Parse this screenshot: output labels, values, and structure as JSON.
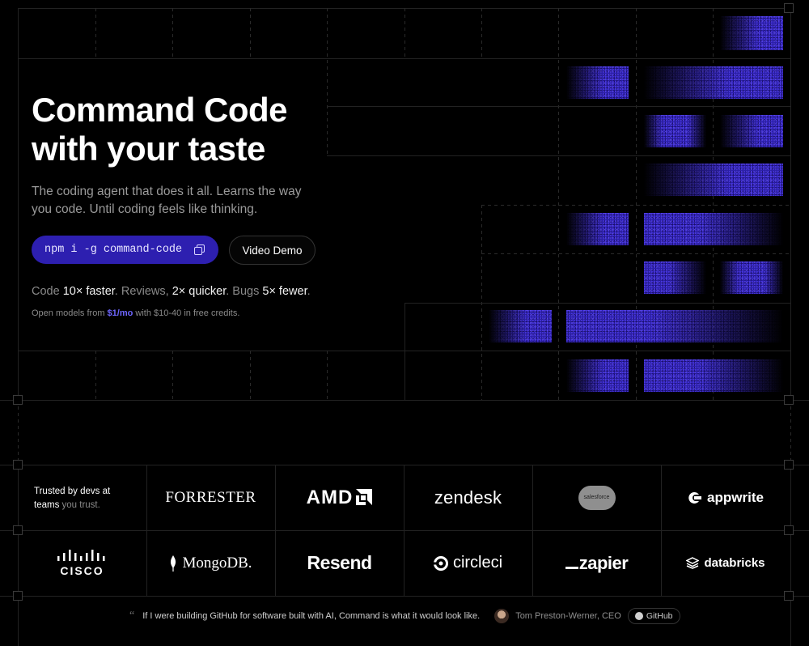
{
  "hero": {
    "title": "Command Code with your taste",
    "subtitle": "The coding agent that does it all. Learns the way you code. Until coding feels like thinking.",
    "install_command": "npm i -g command-code",
    "video_demo_label": "Video Demo",
    "stats": {
      "s1": "Code ",
      "s1b": "10× faster",
      "s2": ". Reviews, ",
      "s2b": "2× quicker",
      "s3": ". Bugs ",
      "s3b": "5× fewer",
      "s4": "."
    },
    "credits": {
      "prefix": "Open models from ",
      "price": "$1/mo",
      "suffix": " with $10-40 in free credits."
    }
  },
  "trusted": {
    "line1": "Trusted by devs at",
    "line2a": "teams ",
    "line2b": "you trust."
  },
  "logos": {
    "forrester": "FORRESTER",
    "amd": "AMD",
    "zendesk": "zendesk",
    "salesforce": "salesforce",
    "appwrite": "appwrite",
    "cisco": "CISCO",
    "mongodb": "MongoDB.",
    "resend": "Resend",
    "circleci": "circleci",
    "zapier": "zapier",
    "databricks": "databricks"
  },
  "quote": {
    "text": "If I were building GitHub for software built with AI, Command is what it would look like.",
    "author": "Tom Preston-Werner, CEO",
    "badge": "GitHub"
  },
  "colors": {
    "accent": "#2d1fb0",
    "link": "#6e66ff",
    "background": "#000000"
  }
}
